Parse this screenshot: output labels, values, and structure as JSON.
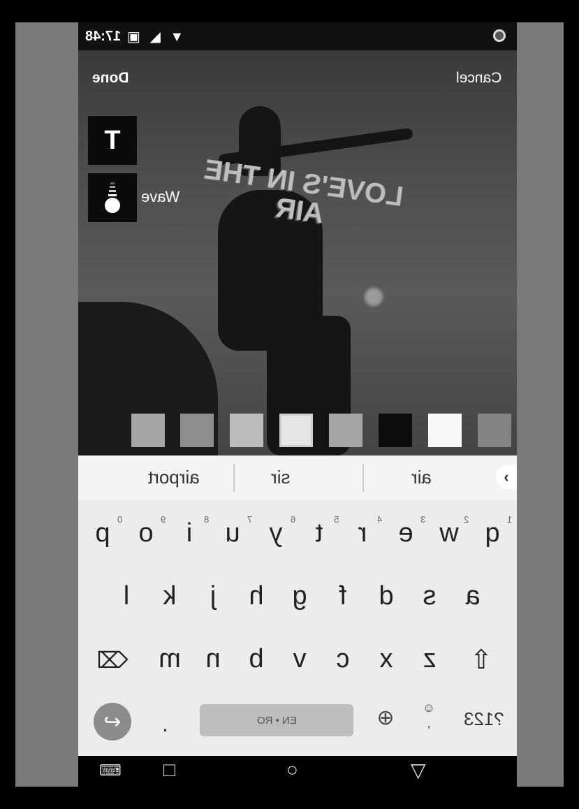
{
  "status_bar": {
    "time": "17:48",
    "icons": "▣ ◢ ▼"
  },
  "header": {
    "done_label": "Done",
    "cancel_label": "Cancel"
  },
  "tools": {
    "text_tool_label": "T",
    "wave_label": "Wave"
  },
  "overlay_text": {
    "line1": "LOVE'S IN THE",
    "line2": "AIR"
  },
  "swatches": [
    "#838383",
    "#f8f8f8",
    "#0c0c0c",
    "#a6a6a6",
    "#e6e6e6",
    "#bcbcbc",
    "#8d8d8d",
    "#a6a6a6"
  ],
  "suggestions": {
    "items": [
      "air",
      "sir",
      "airport"
    ]
  },
  "keyboard": {
    "row1": [
      "q",
      "w",
      "e",
      "r",
      "t",
      "y",
      "u",
      "i",
      "o",
      "p"
    ],
    "row1_hints": [
      "1",
      "2",
      "3",
      "4",
      "5",
      "6",
      "7",
      "8",
      "9",
      "0"
    ],
    "row2": [
      "a",
      "s",
      "d",
      "f",
      "g",
      "h",
      "j",
      "k",
      "l"
    ],
    "row3": [
      "z",
      "x",
      "c",
      "v",
      "b",
      "n",
      "m"
    ],
    "symbols_label": "?123",
    "comma": ",",
    "space_label": "EN • RO",
    "period": "."
  }
}
